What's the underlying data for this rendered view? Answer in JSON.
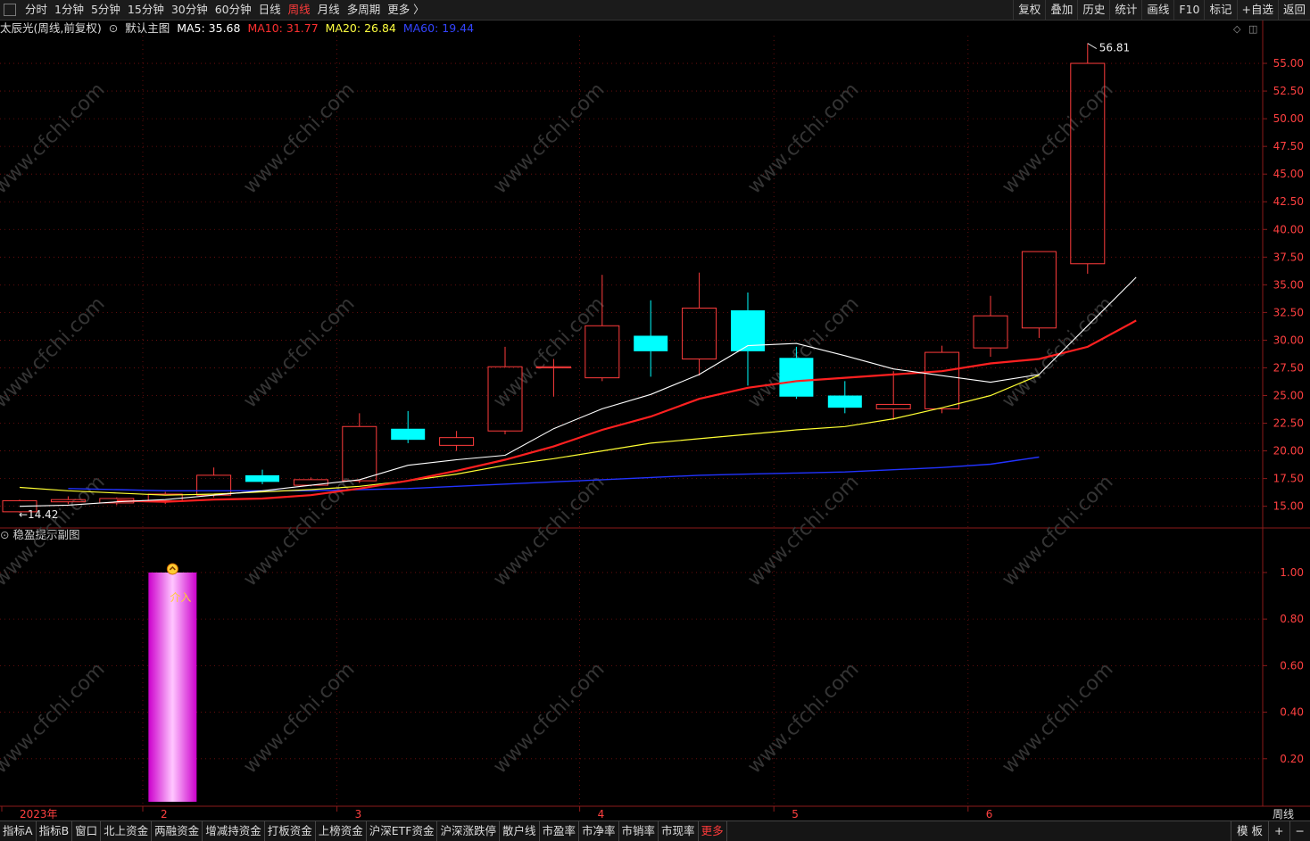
{
  "toolbar": {
    "periods": [
      "分时",
      "1分钟",
      "5分钟",
      "15分钟",
      "30分钟",
      "60分钟",
      "日线",
      "周线",
      "月线",
      "多周期",
      "更多 〉"
    ],
    "active_period": "周线",
    "tools": [
      "复权",
      "叠加",
      "历史",
      "统计",
      "画线",
      "F10",
      "标记",
      "+自选",
      "返回"
    ]
  },
  "info": {
    "stock": "太辰光(周线,前复权)",
    "template": "默认主图",
    "ma5": "MA5: 35.68",
    "ma10": "MA10: 31.77",
    "ma20": "MA20: 26.84",
    "ma60": "MA60: 19.44"
  },
  "sub_panel": {
    "title": "稳盈提示副图",
    "signal_text": "介入"
  },
  "watermark": "www.cfchi.com",
  "colors": {
    "up": "#ff3c3c",
    "down": "#00ffff",
    "ma5": "#ffffff",
    "ma10": "#ff2020",
    "ma20": "#ffff33",
    "ma60": "#2233ff",
    "axis": "#8b1a1a",
    "grid": "#7a1010",
    "label": "#ff4040"
  },
  "chart_data": {
    "type": "candlestick",
    "x_labels": [
      "2023年",
      "2",
      "3",
      "4",
      "5",
      "6"
    ],
    "x_label_candle_index": [
      0,
      3,
      7,
      12,
      16,
      20
    ],
    "y_ticks": [
      15.0,
      17.5,
      20.0,
      22.5,
      25.0,
      27.5,
      30.0,
      32.5,
      35.0,
      37.5,
      40.0,
      42.5,
      45.0,
      47.5,
      50.0,
      52.5,
      55.0
    ],
    "ylim": [
      13.2,
      57.5
    ],
    "annotations": {
      "max": "56.81",
      "min": "14.42"
    },
    "candles": [
      {
        "o": 14.5,
        "h": 15.6,
        "l": 14.42,
        "c": 15.5
      },
      {
        "o": 15.4,
        "h": 15.9,
        "l": 15.2,
        "c": 15.6
      },
      {
        "o": 15.3,
        "h": 15.8,
        "l": 15.1,
        "c": 15.7
      },
      {
        "o": 15.5,
        "h": 16.3,
        "l": 15.2,
        "c": 16.1
      },
      {
        "o": 16.0,
        "h": 18.5,
        "l": 15.8,
        "c": 17.8
      },
      {
        "o": 17.8,
        "h": 18.3,
        "l": 17.0,
        "c": 17.2
      },
      {
        "o": 16.9,
        "h": 17.6,
        "l": 16.8,
        "c": 17.4
      },
      {
        "o": 17.3,
        "h": 23.4,
        "l": 17.1,
        "c": 22.2
      },
      {
        "o": 22.0,
        "h": 23.6,
        "l": 20.7,
        "c": 21.0
      },
      {
        "o": 20.5,
        "h": 21.8,
        "l": 20.0,
        "c": 21.2
      },
      {
        "o": 21.8,
        "h": 29.4,
        "l": 21.5,
        "c": 27.6
      },
      {
        "o": 27.6,
        "h": 28.3,
        "l": 24.9,
        "c": 27.6
      },
      {
        "o": 26.6,
        "h": 35.9,
        "l": 26.3,
        "c": 31.3
      },
      {
        "o": 30.4,
        "h": 33.6,
        "l": 26.7,
        "c": 29.0
      },
      {
        "o": 28.3,
        "h": 36.1,
        "l": 26.8,
        "c": 32.9
      },
      {
        "o": 32.7,
        "h": 34.3,
        "l": 25.9,
        "c": 29.0
      },
      {
        "o": 28.4,
        "h": 29.4,
        "l": 24.7,
        "c": 24.9
      },
      {
        "o": 25.0,
        "h": 26.3,
        "l": 23.4,
        "c": 23.9
      },
      {
        "o": 23.8,
        "h": 27.2,
        "l": 22.8,
        "c": 24.2
      },
      {
        "o": 23.8,
        "h": 29.5,
        "l": 23.4,
        "c": 28.9
      },
      {
        "o": 29.3,
        "h": 34.0,
        "l": 28.5,
        "c": 32.2
      },
      {
        "o": 31.1,
        "h": 38.0,
        "l": 30.2,
        "c": 38.0
      },
      {
        "o": 36.9,
        "h": 56.81,
        "l": 36.0,
        "c": 55.0
      }
    ],
    "ma5": [
      15.0,
      15.1,
      15.4,
      15.6,
      16.0,
      16.4,
      16.9,
      17.4,
      18.7,
      19.2,
      19.6,
      22.0,
      23.8,
      25.1,
      26.9,
      29.5,
      29.7,
      28.6,
      27.4,
      26.8,
      26.2,
      26.9,
      31.3,
      35.68
    ],
    "ma10": [
      null,
      null,
      15.5,
      15.4,
      15.6,
      15.7,
      16.0,
      16.6,
      17.3,
      18.2,
      19.2,
      20.4,
      21.9,
      23.1,
      24.7,
      25.7,
      26.3,
      26.6,
      26.9,
      27.2,
      27.9,
      28.3,
      29.4,
      31.77
    ],
    "ma20": [
      16.7,
      16.4,
      16.2,
      16.0,
      16.1,
      16.3,
      16.5,
      16.8,
      17.3,
      17.9,
      18.7,
      19.3,
      20.0,
      20.7,
      21.1,
      21.5,
      21.9,
      22.2,
      22.9,
      23.9,
      25.0,
      26.84
    ],
    "ma60": [
      null,
      16.6,
      16.5,
      16.4,
      16.4,
      16.4,
      16.4,
      16.5,
      16.6,
      16.8,
      17.0,
      17.2,
      17.4,
      17.6,
      17.8,
      17.9,
      18.0,
      18.1,
      18.3,
      18.5,
      18.8,
      19.44
    ],
    "sub": {
      "y_ticks": [
        0.2,
        0.4,
        0.6,
        0.8,
        1.0
      ],
      "ylim": [
        0.0,
        1.13
      ],
      "bars": [
        {
          "index": 3,
          "value": 1.0
        }
      ]
    }
  }
}
